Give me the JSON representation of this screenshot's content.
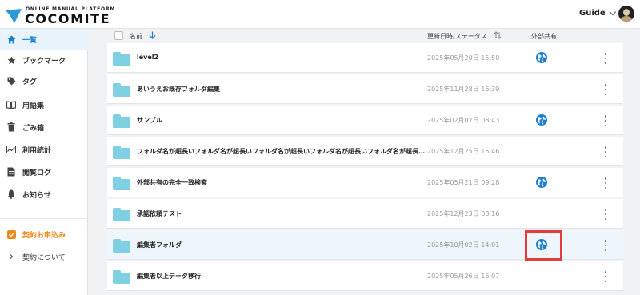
{
  "header": {
    "logo_sub": "ONLINE MANUAL PLATFORM",
    "logo_main": "COCOMITE",
    "guide_label": "Guide",
    "brand_color": "#1a7fd0"
  },
  "sidebar": {
    "items": [
      {
        "label": "一覧",
        "icon": "home-icon",
        "active": true
      },
      {
        "label": "ブックマーク",
        "icon": "star-icon"
      },
      {
        "label": "タグ",
        "icon": "tag-icon"
      },
      {
        "label": "用語集",
        "icon": "book-icon"
      },
      {
        "label": "ごみ箱",
        "icon": "trash-icon"
      },
      {
        "label": "利用統計",
        "icon": "chart-icon"
      },
      {
        "label": "閲覧ログ",
        "icon": "document-icon"
      },
      {
        "label": "お知らせ",
        "icon": "bell-icon"
      },
      {
        "label": "契約お申込み",
        "icon": "checkbox-icon",
        "accent": "#f08a1c"
      },
      {
        "label": "契約について",
        "icon": "chevron-right-icon"
      }
    ]
  },
  "table": {
    "col_name": "名前",
    "col_updated": "更新日時/ステータス",
    "col_share": "外部共有",
    "rows": [
      {
        "name": "level2",
        "date": "2025年05月20日 15:50",
        "shared": true
      },
      {
        "name": "あいうえお既存フォルダ編集",
        "date": "2025年11月28日 16:39",
        "shared": false
      },
      {
        "name": "サンプル",
        "date": "2025年02月07日 08:43",
        "shared": true
      },
      {
        "name": "フォルダ名が超長いフォルダ名が超長いフォルダ名が超長いフォルダ名が超長いフォルダ名が超長…",
        "date": "2025年12月25日 15:46",
        "shared": false
      },
      {
        "name": "外部共有の完全一致検索",
        "date": "2025年05月21日 09:28",
        "shared": true
      },
      {
        "name": "承認依頼テスト",
        "date": "2025年12月23日 08:16",
        "shared": false
      },
      {
        "name": "編集者フォルダ",
        "date": "2025年10月02日 14:01",
        "shared": true,
        "highlighted": true
      },
      {
        "name": "編集者以上データ移行",
        "date": "2025年05月26日 16:07",
        "shared": false
      }
    ]
  },
  "colors": {
    "folder": "#7fd0e2",
    "globe": "#1a7fd0",
    "highlight_box": "#e53b3b"
  }
}
